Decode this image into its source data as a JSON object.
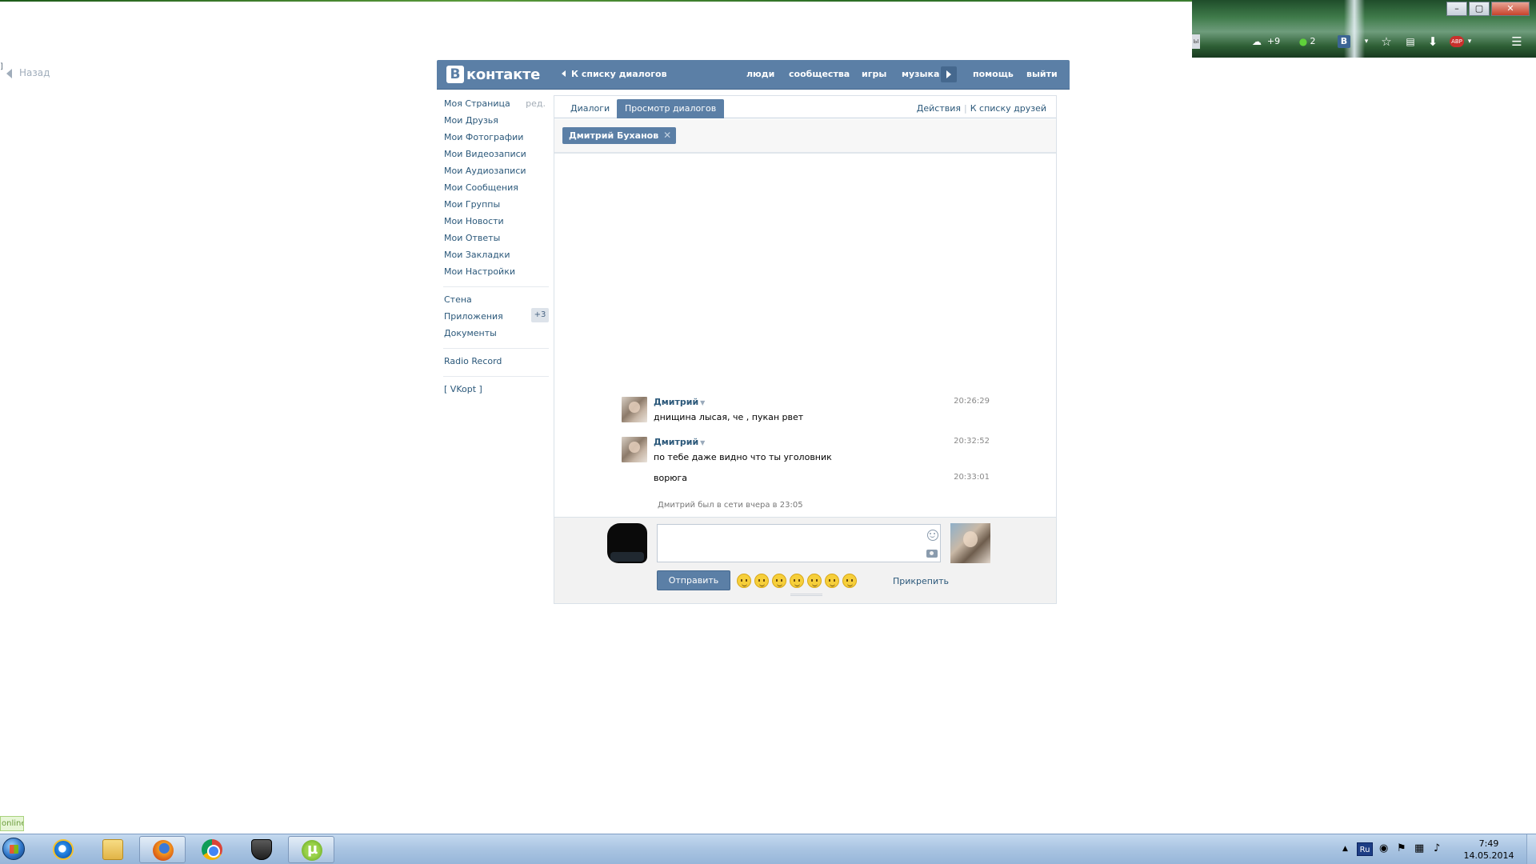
{
  "chrome": {
    "window_controls": [
      "–",
      "▢",
      "✕"
    ],
    "toolbar": {
      "search_stub": "ы",
      "weather": "+9",
      "green_badge": "2",
      "vk_ext": "В",
      "abp": "ABP"
    }
  },
  "page": {
    "back_label": "Назад",
    "corner_mark": "]"
  },
  "header": {
    "logo_letter": "В",
    "logo_text": "контакте",
    "dialogs_link": "К списку диалогов",
    "nav": [
      "люди",
      "сообщества",
      "игры",
      "музыка",
      "помощь",
      "выйти"
    ]
  },
  "left_menu": {
    "edit_label": "ред.",
    "items": [
      "Моя Страница",
      "Мои Друзья",
      "Мои Фотографии",
      "Мои Видеозаписи",
      "Мои Аудиозаписи",
      "Мои Сообщения",
      "Мои Группы",
      "Мои Новости",
      "Мои Ответы",
      "Мои Закладки",
      "Мои Настройки"
    ],
    "extra": [
      "Стена",
      "Приложения",
      "Документы"
    ],
    "apps_badge": "+3",
    "radio": "Radio Record",
    "vkopt": "[ VKopt ]"
  },
  "main": {
    "tabs": [
      {
        "label": "Диалоги",
        "active": false
      },
      {
        "label": "Просмотр диалогов",
        "active": true
      }
    ],
    "actions_label": "Действия",
    "friends_list_label": "К списку друзей",
    "chip_name": "Дмитрий Буханов",
    "chip_close": "✕",
    "messages": [
      {
        "author": "Дмитрий",
        "time": "20:26:29",
        "text": "днищина лысая, че , пукан рвет"
      },
      {
        "author": "Дмитрий",
        "time": "20:32:52",
        "text": "по тебе даже видно что ты уголовник"
      },
      {
        "author": "",
        "time": "20:33:01",
        "text": "ворюга"
      }
    ],
    "last_seen": "Дмитрий был в сети вчера в 23:05",
    "input_value": "",
    "send_label": "Отправить",
    "attach_label": "Прикрепить"
  },
  "status": {
    "online_tag": "online"
  },
  "taskbar": {
    "language": "Ru",
    "time": "7:49",
    "date": "14.05.2014"
  },
  "colors": {
    "vk_blue": "#5b7fa6",
    "link": "#2b587a",
    "taskbar": "#a9c4e2"
  }
}
